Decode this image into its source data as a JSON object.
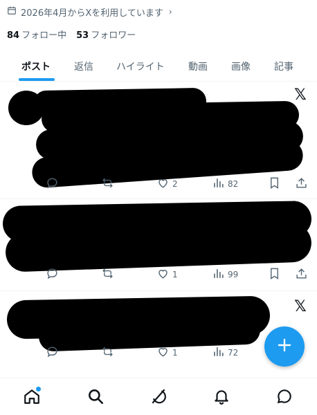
{
  "profile": {
    "joined": "2026年4月からXを利用しています",
    "following_count": "84",
    "following_label": "フォロー中",
    "followers_count": "53",
    "followers_label": "フォロワー"
  },
  "tabs": [
    {
      "label": "ポスト",
      "active": true
    },
    {
      "label": "返信",
      "active": false
    },
    {
      "label": "ハイライト",
      "active": false
    },
    {
      "label": "動画",
      "active": false
    },
    {
      "label": "画像",
      "active": false
    },
    {
      "label": "記事",
      "active": false
    }
  ],
  "posts": [
    {
      "likes": "2",
      "views": "82",
      "source_icon": "x-logo"
    },
    {
      "likes": "1",
      "views": "99"
    },
    {
      "likes": "1",
      "views": "72",
      "source_icon": "x-logo"
    }
  ],
  "colors": {
    "accent": "#1d9bf0",
    "text": "#0f1419",
    "muted": "#536471"
  },
  "icons": [
    "calendar-icon",
    "reply-icon",
    "repost-icon",
    "like-icon",
    "views-icon",
    "bookmark-icon",
    "share-icon",
    "compose-icon",
    "home-icon",
    "search-icon",
    "grok-icon",
    "notifications-icon",
    "messages-icon"
  ]
}
